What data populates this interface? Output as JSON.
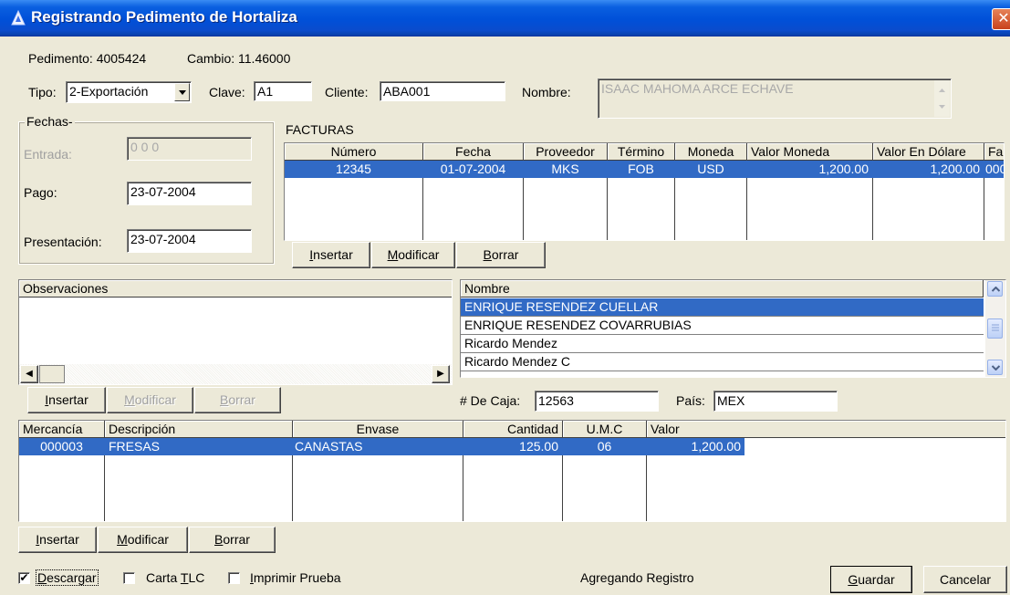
{
  "window": {
    "title": "Registrando Pedimento de Hortaliza",
    "close_glyph": "✕"
  },
  "header": {
    "pedimento": "Pedimento: 4005424",
    "cambio": "Cambio: 11.46000"
  },
  "form": {
    "tipo_label": "Tipo:",
    "tipo_value": "2-Exportación",
    "clave_label": "Clave:",
    "clave_value": "A1",
    "cliente_label": "Cliente:",
    "cliente_value": "ABA001",
    "nombre_label": "Nombre:",
    "nombre_value": "ISAAC MAHOMA ARCE ECHAVE"
  },
  "fechas": {
    "title": "Fechas-",
    "entrada_label": "Entrada:",
    "entrada_value": "0 0  0",
    "pago_label": "Pago:",
    "pago_value": "23-07-2004",
    "presentacion_label": "Presentación:",
    "presentacion_value": "23-07-2004"
  },
  "facturas": {
    "title": "FACTURAS",
    "columns": [
      "Número",
      "Fecha",
      "Proveedor",
      "Término",
      "Moneda",
      "Valor Moneda",
      "Valor En Dólare",
      "Fa"
    ],
    "rows": [
      [
        "12345",
        "01-07-2004",
        "MKS",
        "FOB",
        "USD",
        "1,200.00",
        "1,200.00",
        "000"
      ]
    ],
    "buttons": {
      "insertar": {
        "pre": "",
        "key": "I",
        "post": "nsertar"
      },
      "modificar": {
        "pre": "",
        "key": "M",
        "post": "odificar"
      },
      "borrar": {
        "pre": "",
        "key": "B",
        "post": "orrar"
      }
    }
  },
  "observaciones": {
    "header": "Observaciones",
    "buttons": {
      "insertar": {
        "pre": "",
        "key": "I",
        "post": "nsertar"
      },
      "modificar": {
        "pre": "",
        "key": "M",
        "post": "odificar"
      },
      "borrar": {
        "pre": "",
        "key": "B",
        "post": "orrar"
      }
    }
  },
  "nombres": {
    "header": "Nombre",
    "items": [
      "ENRIQUE RESENDEZ CUELLAR",
      "ENRIQUE RESENDEZ COVARRUBIAS",
      "Ricardo Mendez",
      "Ricardo Mendez C"
    ],
    "selected_index": 0
  },
  "caja": {
    "label": "# De Caja:",
    "value": "12563",
    "pais_label": "País:",
    "pais_value": "MEX"
  },
  "mercancias": {
    "columns": [
      "Mercancía",
      "Descripción",
      "Envase",
      "Cantidad",
      "U.M.C",
      "Valor"
    ],
    "rows": [
      [
        "000003",
        "FRESAS",
        "CANASTAS",
        "125.00",
        "06",
        "1,200.00"
      ]
    ],
    "buttons": {
      "insertar": {
        "pre": "",
        "key": "I",
        "post": "nsertar"
      },
      "modificar": {
        "pre": "",
        "key": "M",
        "post": "odificar"
      },
      "borrar": {
        "pre": "",
        "key": "B",
        "post": "orrar"
      }
    }
  },
  "footer": {
    "descargar": {
      "pre": "",
      "key": "D",
      "post": "escargar",
      "checked": true
    },
    "carta_tlc": {
      "pre": "Carta ",
      "key": "T",
      "post": "LC",
      "checked": false
    },
    "imprimir_prueba": {
      "pre": "",
      "key": "I",
      "post": "mprimir Prueba",
      "checked": false
    },
    "check_glyph": "✔",
    "status": "Agregando Registro",
    "guardar": {
      "pre": "",
      "key": "G",
      "post": "uardar"
    },
    "cancelar": "Cancelar"
  },
  "colors": {
    "face": "#ECE9D8",
    "selection": "#316AC5",
    "titlebar": "#0a5fe0"
  }
}
